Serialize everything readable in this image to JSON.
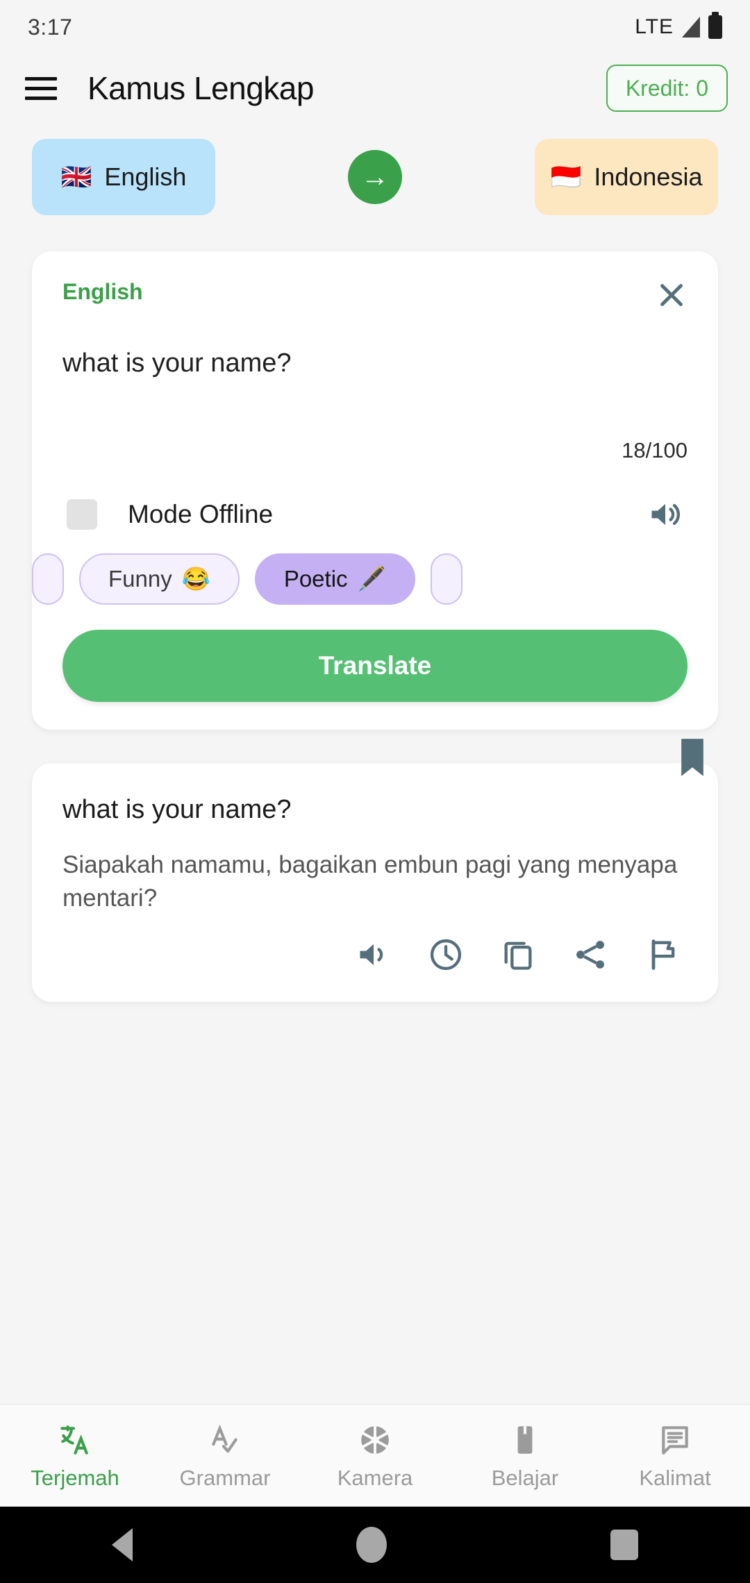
{
  "status_bar": {
    "time": "3:17",
    "network": "LTE",
    "signal_icon": "signal-bars-icon",
    "battery_icon": "battery-full-icon"
  },
  "header": {
    "menu_icon": "hamburger-menu-icon",
    "title": "Kamus Lengkap",
    "credit_label": "Kredit: 0",
    "credit_border_color": "#4caf50"
  },
  "language_bar": {
    "source": {
      "flag": "🇬🇧",
      "name": "English",
      "bg_color": "#b9e2fb"
    },
    "swap": {
      "icon": "arrow-right-icon",
      "glyph": "→",
      "bg_color": "#3ba04a"
    },
    "target": {
      "flag": "🇮🇩",
      "name": "Indonesia",
      "bg_color": "#fce7c0"
    }
  },
  "input_card": {
    "language_label": "English",
    "language_label_color": "#3ba04a",
    "close_icon": "close-icon",
    "text": "what is your name?",
    "char_count": "18/100",
    "offline": {
      "label": "Mode Offline",
      "checked": false
    },
    "speak_icon": "speaker-icon",
    "style_chips": [
      {
        "label": "",
        "emoji": "",
        "selected": false,
        "partial": true
      },
      {
        "label": "Funny",
        "emoji": "😂",
        "selected": false,
        "partial": false
      },
      {
        "label": "Poetic",
        "emoji": "🖋️",
        "selected": true,
        "partial": false
      },
      {
        "label": "",
        "emoji": "",
        "selected": false,
        "partial": true
      }
    ],
    "translate_button": "Translate",
    "translate_button_color": "#55c074"
  },
  "result_card": {
    "bookmark_icon": "bookmark-icon",
    "source_text": "what is your name?",
    "translated_text": "Siapakah namamu, bagaikan embun pagi yang menyapa mentari?",
    "actions": [
      {
        "name": "speaker-icon",
        "label": "Listen"
      },
      {
        "name": "clock-icon",
        "label": "History"
      },
      {
        "name": "copy-icon",
        "label": "Copy"
      },
      {
        "name": "share-icon",
        "label": "Share"
      },
      {
        "name": "flag-icon",
        "label": "Report"
      }
    ]
  },
  "bottom_nav": {
    "active_color": "#3ba04a",
    "inactive_color": "#9b9b9b",
    "items": [
      {
        "label": "Terjemah",
        "icon": "translate-icon",
        "active": true
      },
      {
        "label": "Grammar",
        "icon": "spellcheck-icon",
        "active": false
      },
      {
        "label": "Kamera",
        "icon": "camera-aperture-icon",
        "active": false
      },
      {
        "label": "Belajar",
        "icon": "bookmark-icon",
        "active": false
      },
      {
        "label": "Kalimat",
        "icon": "chat-lines-icon",
        "active": false
      }
    ]
  },
  "android_nav": {
    "back_icon": "back-triangle-icon",
    "home_icon": "home-circle-icon",
    "recents_icon": "recents-square-icon"
  }
}
